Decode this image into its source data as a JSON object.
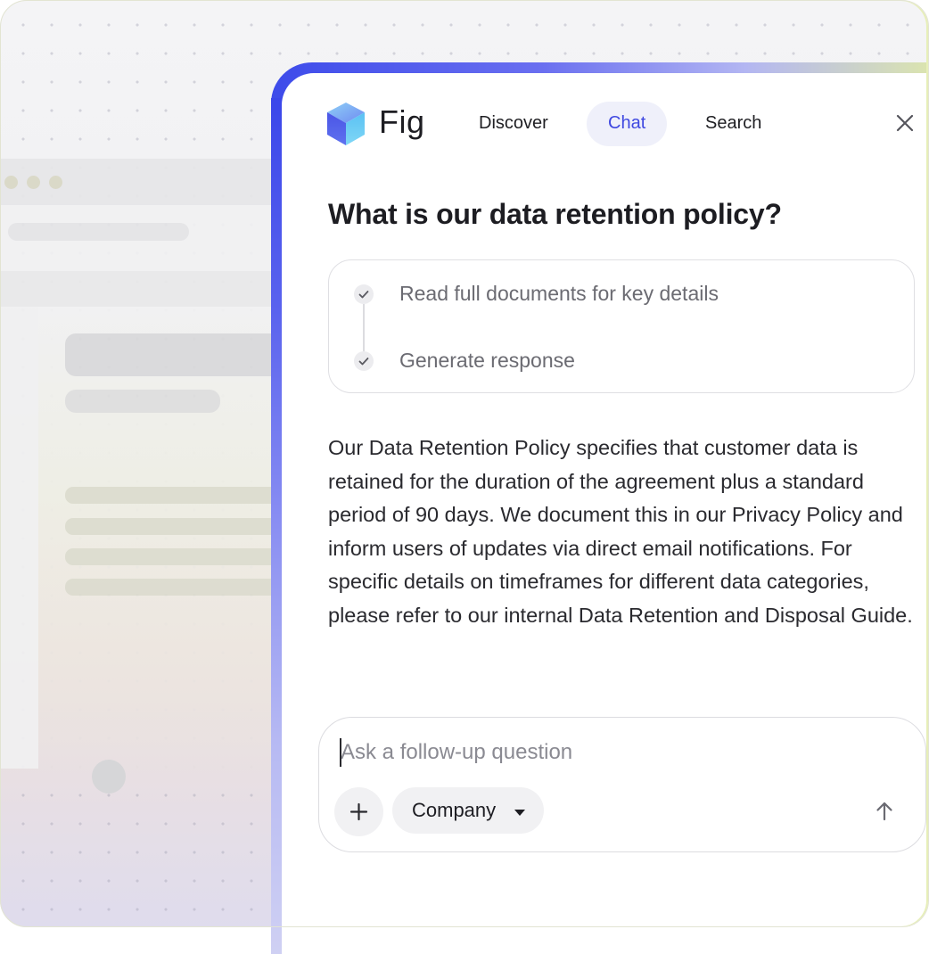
{
  "app": {
    "name": "Fig"
  },
  "nav": {
    "tabs": [
      {
        "label": "Discover"
      },
      {
        "label": "Chat",
        "active": true
      },
      {
        "label": "Search"
      }
    ]
  },
  "chat": {
    "question": "What is our data retention policy?",
    "steps": [
      {
        "label": "Read full documents for key details",
        "status": "done"
      },
      {
        "label": "Generate response",
        "status": "done"
      }
    ],
    "answer": "Our Data Retention Policy specifies that customer data is retained for the duration of the agreement plus a standard period of 90 days. We document this in our Privacy Policy and inform users of updates via direct email notifications. For specific details on timeframes for different data categories, please refer to our internal Data Retention and Disposal Guide."
  },
  "composer": {
    "placeholder": "Ask a follow-up question",
    "scope_label": "Company"
  },
  "icons": {
    "logo": "cube-logo-icon",
    "close": "close-icon",
    "check": "check-icon",
    "add": "plus-icon",
    "dropdown": "caret-down-icon",
    "send": "arrow-up-icon"
  },
  "colors": {
    "accent": "#3f48e0",
    "active_tab_bg": "#eff0fa",
    "border_gradient_start": "#3d4bea",
    "border_gradient_end": "#dfe9a8"
  }
}
